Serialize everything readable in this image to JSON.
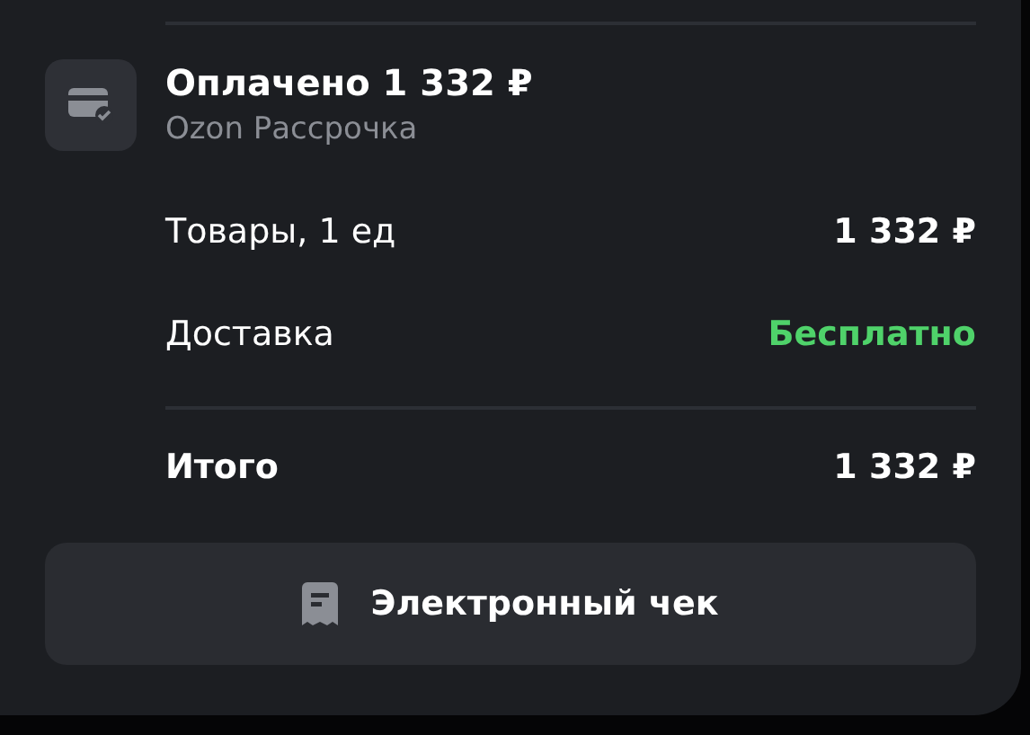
{
  "payment": {
    "title": "Оплачено 1 332 ₽",
    "method": "Ozon Рассрочка"
  },
  "summary": [
    {
      "label": "Товары, 1 ед",
      "value": "1 332 ₽",
      "kind": "normal"
    },
    {
      "label": "Доставка",
      "value": "Бесплатно",
      "kind": "free"
    }
  ],
  "total": {
    "label": "Итого",
    "value": "1 332 ₽"
  },
  "receipt_button": {
    "label": "Электронный чек"
  }
}
